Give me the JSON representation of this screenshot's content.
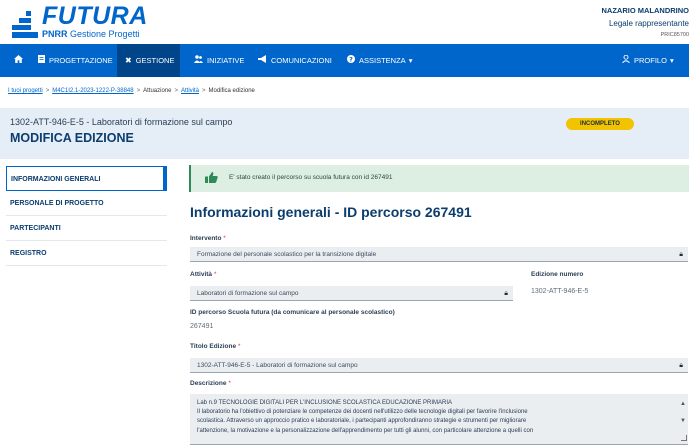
{
  "brand": {
    "title": "FUTURA",
    "subtitle_bold": "PNRR",
    "subtitle_rest": "Gestione Progetti",
    "color": "#0066cc"
  },
  "user": {
    "name": "NAZARIO MALANDRINO",
    "role": "Legale rappresentante",
    "code": "PRIC85700"
  },
  "navbar": {
    "home_icon": "home-icon",
    "items": [
      {
        "label": "PROGETTAZIONE",
        "icon": "document-icon"
      },
      {
        "label": "GESTIONE",
        "icon": "tools-icon"
      },
      {
        "label": "INIZIATIVE",
        "icon": "people-icon"
      },
      {
        "label": "COMUNICAZIONI",
        "icon": "megaphone-icon"
      },
      {
        "label": "ASSISTENZA",
        "icon": "help-icon"
      }
    ],
    "profile": "PROFILO",
    "color": "#0066cc",
    "active_color": "#00448a"
  },
  "breadcrumb": {
    "items": [
      "I tuoi progetti",
      "M4C1I2.1-2023-1222-P-38848",
      "Attuazione",
      "Attività",
      "Modifica edizione"
    ],
    "separator": ">"
  },
  "page": {
    "code": "1302-ATT-946-E-5 - Laboratori di formazione sul campo",
    "heading": "MODIFICA EDIZIONE",
    "status": "INCOMPLETO",
    "status_color": "#f2c400"
  },
  "sidebar": {
    "items": [
      {
        "label": "INFORMAZIONI GENERALI"
      },
      {
        "label": "PERSONALE DI PROGETTO"
      },
      {
        "label": "PARTECIPANTI"
      },
      {
        "label": "REGISTRO"
      }
    ]
  },
  "alert": {
    "message": "E' stato creato il percorso su scuola futura con id 267491"
  },
  "section": {
    "title": "Informazioni generali - ID percorso 267491"
  },
  "form": {
    "intervento": {
      "label": "Intervento",
      "value": "Formazione del personale scolastico per la transizione digitale"
    },
    "attivita": {
      "label": "Attività",
      "value": "Laboratori di formazione sul campo"
    },
    "edizione": {
      "label": "Edizione numero",
      "value": "1302-ATT-946-E-5"
    },
    "id_percorso": {
      "label": "ID percorso Scuola futura (da comunicare al personale scolastico)",
      "value": "267491"
    },
    "titolo": {
      "label": "Titolo Edizione",
      "value": "1302-ATT-946-E-5 - Laboratori di formazione sul campo"
    },
    "descrizione": {
      "label": "Descrizione",
      "lines": [
        "Lab n.9 TECNOLOGIE DIGITALI PER L'INCLUSIONE SCOLASTICA EDUCAZIONE PRIMARIA",
        "Il laboratorio ha l'obiettivo di potenziare le competenze dei docenti nell'utilizzo delle tecnologie digitali per favorire l'inclusione",
        "scolastica. Attraverso un approccio pratico e laboratoriale, i partecipanti approfondiranno strategie e strumenti per migliorare",
        "l'attenzione, la motivazione e la personalizzazione dell'apprendimento per tutti gli alunni, con particolare attenzione a quelli con"
      ]
    },
    "required_mark": "*"
  }
}
